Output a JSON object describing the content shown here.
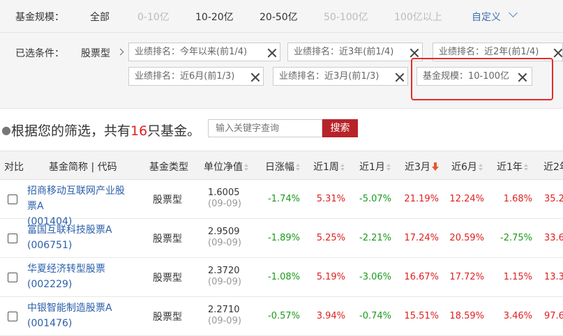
{
  "filters": {
    "fund_size_label": "基金规模：",
    "size_options": [
      {
        "label": "全部",
        "state": "on"
      },
      {
        "label": "0-10亿",
        "state": "dim"
      },
      {
        "label": "10-20亿",
        "state": "on"
      },
      {
        "label": "20-50亿",
        "state": "on"
      },
      {
        "label": "50-100亿",
        "state": "dim"
      },
      {
        "label": "100亿以上",
        "state": "dim"
      }
    ],
    "custom_label": "自定义",
    "selected_label": "已选条件：",
    "fund_type_crumb": "股票型",
    "chips": [
      "业绩排名：今年以来(前1/4)",
      "业绩排名：近3年(前1/4)",
      "业绩排名：近2年(前1/4)",
      "业绩排名：近6月(前1/3)",
      "业绩排名：近3月(前1/3)",
      "基金规模：10-100亿"
    ]
  },
  "summary": {
    "prefix": "根据您的筛选，共有",
    "count": "16",
    "suffix": "只基金。",
    "bullet": "●"
  },
  "search": {
    "placeholder": "输入关键字查询",
    "button": "搜索"
  },
  "table": {
    "headers": [
      "对比",
      "基金简称 | 代码",
      "基金类型",
      "单位净值",
      "日涨幅",
      "近1周",
      "近1月",
      "近3月",
      "近6月",
      "近1年",
      "近2年"
    ],
    "rows": [
      {
        "name": "招商移动互联网产业股票A",
        "code": "(001404)",
        "type": "股票型",
        "nav": "1.6005",
        "date": "(09-09)",
        "vals": [
          "-1.74%",
          "5.31%",
          "-5.07%",
          "21.19%",
          "12.24%",
          "1.68%",
          "35.2"
        ]
      },
      {
        "name": "富国互联科技股票A",
        "code": "(006751)",
        "type": "股票型",
        "nav": "2.9509",
        "date": "(09-09)",
        "vals": [
          "-1.89%",
          "5.25%",
          "-2.21%",
          "17.24%",
          "20.59%",
          "-2.75%",
          "33.6"
        ]
      },
      {
        "name": "华夏经济转型股票",
        "code": "(002229)",
        "type": "股票型",
        "nav": "2.3720",
        "date": "(09-09)",
        "vals": [
          "-1.08%",
          "5.19%",
          "-3.06%",
          "16.67%",
          "17.72%",
          "1.15%",
          "13.3"
        ]
      },
      {
        "name": "中银智能制造股票A",
        "code": "(001476)",
        "type": "股票型",
        "nav": "2.2710",
        "date": "(09-09)",
        "vals": [
          "-0.57%",
          "3.94%",
          "-0.74%",
          "15.51%",
          "18.59%",
          "3.46%",
          "97.6"
        ]
      }
    ]
  }
}
